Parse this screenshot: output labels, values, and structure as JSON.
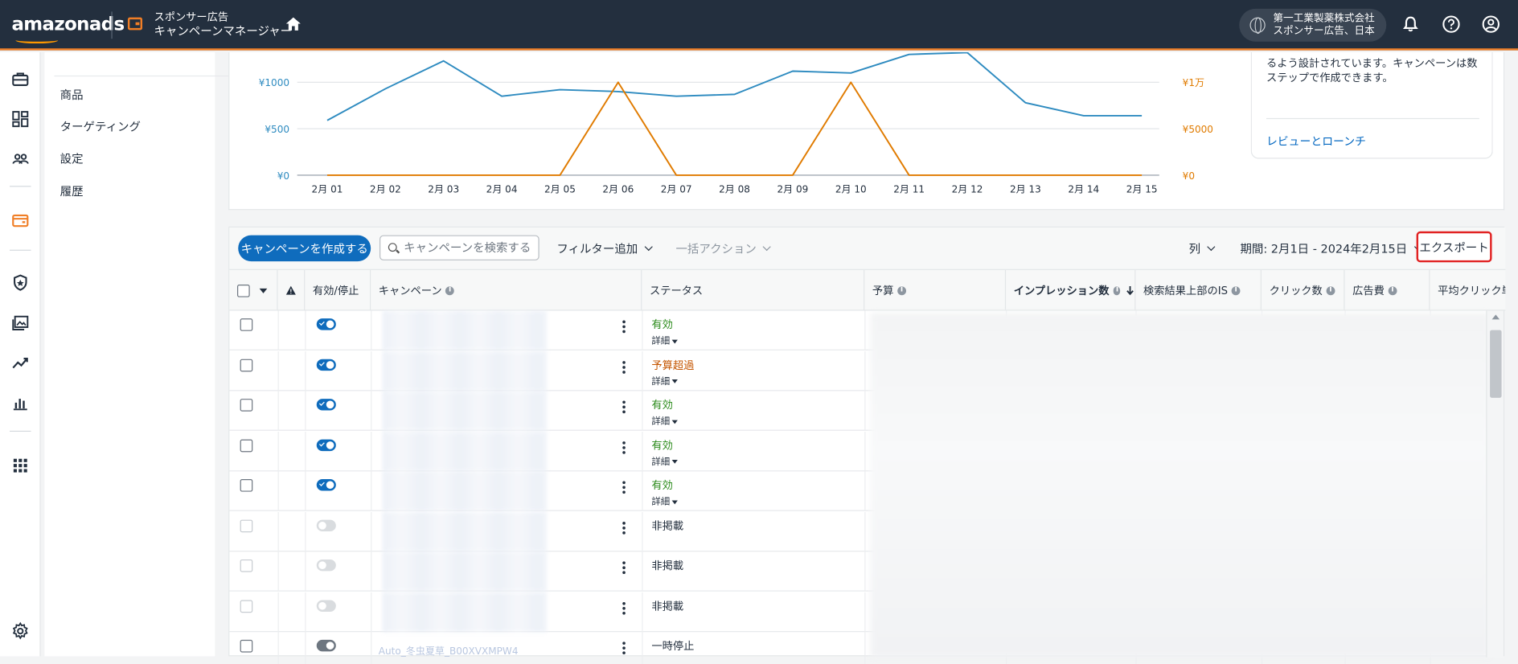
{
  "header": {
    "logo": "amazonads",
    "product_line1": "スポンサー広告",
    "product_line2": "キャンペーンマネージャー",
    "account_name": "第一工業製薬株式会社",
    "account_sub": "スポンサー広告、日本"
  },
  "subnav": {
    "items": [
      "商品",
      "ターゲティング",
      "設定",
      "履歴"
    ]
  },
  "side_card": {
    "description": "るよう設計されています。キャンペーンは数ステップで作成できます。",
    "link": "レビューとローンチ"
  },
  "chart_data": {
    "type": "line",
    "categories": [
      "2月 01",
      "2月 02",
      "2月 03",
      "2月 04",
      "2月 05",
      "2月 06",
      "2月 07",
      "2月 08",
      "2月 09",
      "2月 10",
      "2月 11",
      "2月 12",
      "2月 13",
      "2月 14",
      "2月 15"
    ],
    "left_axis": {
      "ticks": [
        "¥1000",
        "¥500",
        "¥0"
      ],
      "ylim": [
        0,
        1000
      ],
      "color": "#2e8bc0"
    },
    "right_axis": {
      "ticks": [
        "¥1万",
        "¥5000",
        "¥0"
      ],
      "ylim": [
        0,
        10000
      ],
      "color": "#e07b00"
    },
    "series": [
      {
        "axis": "left",
        "color": "#2e8bc0",
        "values": [
          590,
          930,
          1230,
          850,
          920,
          900,
          850,
          870,
          1120,
          1100,
          1300,
          1320,
          780,
          640,
          640
        ]
      },
      {
        "axis": "right",
        "color": "#e07b00",
        "values": [
          0,
          0,
          0,
          0,
          0,
          10000,
          0,
          0,
          0,
          10000,
          0,
          0,
          0,
          0,
          0
        ]
      }
    ],
    "grid": true
  },
  "toolbar": {
    "create_label": "キャンペーンを作成する",
    "search_placeholder": "キャンペーンを検索する",
    "filter_label": "フィルター追加",
    "bulk_label": "一括アクション",
    "columns_label": "列",
    "period_label": "期間: 2月1日 - 2024年2月15日",
    "export_label": "エクスポート"
  },
  "table": {
    "columns": [
      "有効/停止",
      "キャンペーン",
      "ステータス",
      "予算",
      "インプレッション数",
      "検索結果上部のIS",
      "クリック数",
      "広告費",
      "平均クリック単"
    ],
    "detail_label": "詳細",
    "rows": [
      {
        "status": "有効",
        "tone": "green",
        "detail": true,
        "toggle": "on"
      },
      {
        "status": "予算超過",
        "tone": "orange",
        "detail": true,
        "toggle": "on"
      },
      {
        "status": "有効",
        "tone": "green",
        "detail": true,
        "toggle": "on"
      },
      {
        "status": "有効",
        "tone": "green",
        "detail": true,
        "toggle": "on"
      },
      {
        "status": "有効",
        "tone": "green",
        "detail": true,
        "toggle": "on"
      },
      {
        "status": "非掲載",
        "tone": "gray",
        "detail": false,
        "toggle": "off"
      },
      {
        "status": "非掲載",
        "tone": "gray",
        "detail": false,
        "toggle": "off"
      },
      {
        "status": "非掲載",
        "tone": "gray",
        "detail": false,
        "toggle": "off"
      },
      {
        "status": "一時停止",
        "tone": "gray",
        "detail": false,
        "toggle": "paused",
        "name": "Auto_冬虫夏草_B00XVXMPW4"
      }
    ]
  }
}
